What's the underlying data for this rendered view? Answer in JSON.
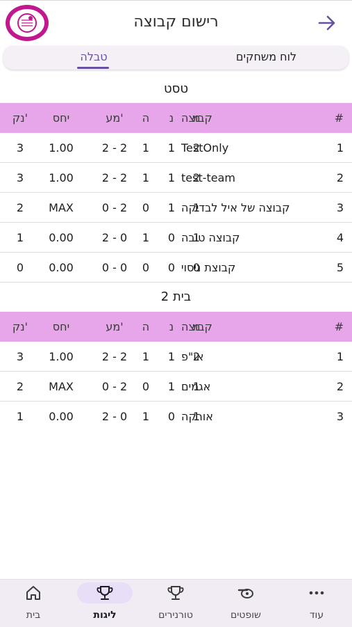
{
  "header": {
    "title": "רישום קבוצה"
  },
  "tabs": {
    "players": "לוח משחקים",
    "table": "טבלה"
  },
  "columns": {
    "rank": "#",
    "team": "קבוצה",
    "m": "מ",
    "n": "נ",
    "h": "ה",
    "goals": "מע'",
    "ratio": "יחס",
    "pts": "נק'"
  },
  "groups": [
    {
      "title": "טסט",
      "rows": [
        {
          "rank": "1",
          "team": "TestOnly",
          "m": "2",
          "n": "1",
          "h": "1",
          "goals": "2 - 2",
          "ratio": "1.00",
          "pts": "3"
        },
        {
          "rank": "2",
          "team": "test-team",
          "m": "2",
          "n": "1",
          "h": "1",
          "goals": "2 - 2",
          "ratio": "1.00",
          "pts": "3"
        },
        {
          "rank": "3",
          "team": "קבוצה של איל לבדיקה",
          "m": "1",
          "n": "1",
          "h": "0",
          "goals": "0 - 2",
          "ratio": "MAX",
          "pts": "2"
        },
        {
          "rank": "4",
          "team": "קבוצה טובה",
          "m": "1",
          "n": "0",
          "h": "1",
          "goals": "2 - 0",
          "ratio": "0.00",
          "pts": "1"
        },
        {
          "rank": "5",
          "team": "קבוצת ניסוי",
          "m": "0",
          "n": "0",
          "h": "0",
          "goals": "0 - 0",
          "ratio": "0.00",
          "pts": "0"
        }
      ]
    },
    {
      "title": "בית 2",
      "rows": [
        {
          "rank": "1",
          "team": "או\"פ",
          "m": "2",
          "n": "1",
          "h": "1",
          "goals": "2 - 2",
          "ratio": "1.00",
          "pts": "3"
        },
        {
          "rank": "2",
          "team": "אגמים",
          "m": "1",
          "n": "1",
          "h": "0",
          "goals": "0 - 2",
          "ratio": "MAX",
          "pts": "2"
        },
        {
          "rank": "3",
          "team": "אורקה",
          "m": "1",
          "n": "0",
          "h": "1",
          "goals": "2 - 0",
          "ratio": "0.00",
          "pts": "1"
        }
      ]
    }
  ],
  "nav": [
    {
      "label": "עוד",
      "icon": "more-icon"
    },
    {
      "label": "שופטים",
      "icon": "whistle-icon"
    },
    {
      "label": "טורנירים",
      "icon": "trophy-icon"
    },
    {
      "label": "ליגות",
      "icon": "trophy-icon",
      "active": true
    },
    {
      "label": "בית",
      "icon": "home-icon"
    }
  ],
  "colors": {
    "accent": "#6750a4",
    "header_row": "#e7a5ea",
    "logo": "#c2188f",
    "nav_bg": "#f1ecf4"
  }
}
